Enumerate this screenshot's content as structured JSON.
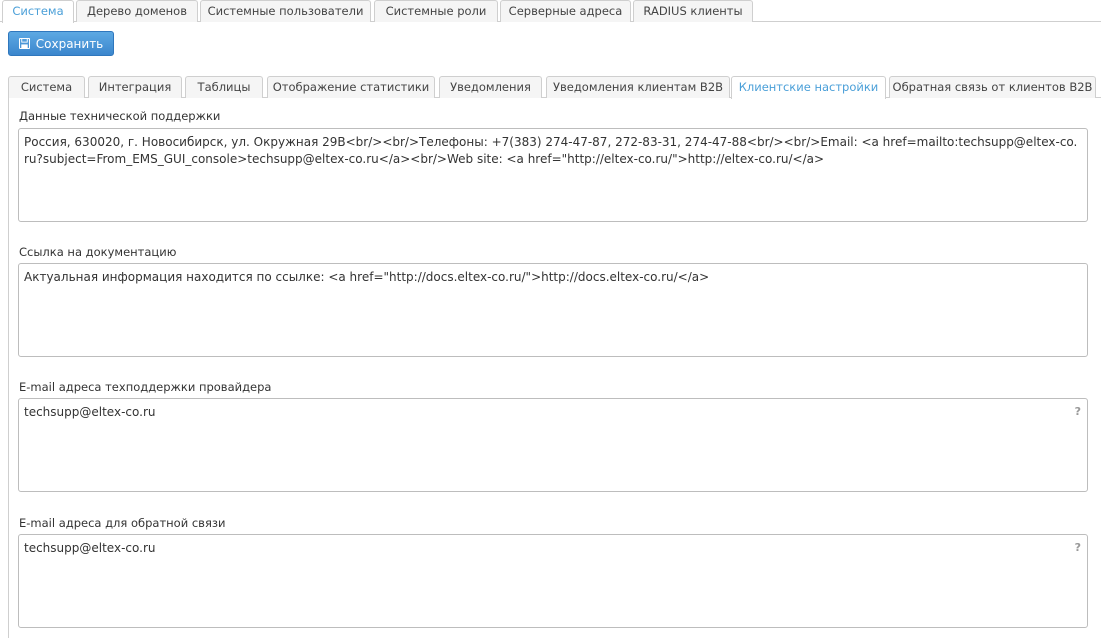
{
  "top_tabs": [
    {
      "label": "Система",
      "active": true
    },
    {
      "label": "Дерево доменов",
      "active": false
    },
    {
      "label": "Системные пользователи",
      "active": false
    },
    {
      "label": "Системные роли",
      "active": false
    },
    {
      "label": "Серверные адреса",
      "active": false
    },
    {
      "label": "RADIUS клиенты",
      "active": false
    }
  ],
  "toolbar": {
    "save_label": "Сохранить",
    "save_icon": "floppy-disk-icon"
  },
  "sub_tabs": [
    {
      "label": "Система",
      "active": false
    },
    {
      "label": "Интеграция",
      "active": false
    },
    {
      "label": "Таблицы",
      "active": false
    },
    {
      "label": "Отображение статистики",
      "active": false
    },
    {
      "label": "Уведомления",
      "active": false
    },
    {
      "label": "Уведомления клиентам B2B",
      "active": false
    },
    {
      "label": "Клиентские настройки",
      "active": true
    },
    {
      "label": "Обратная связь от клиентов B2B",
      "active": false
    }
  ],
  "fields": {
    "support_data": {
      "label": "Данные технической поддержки",
      "value": "Россия, 630020, г. Новосибирск, ул. Окружная 29В<br/><br/>Телефоны: +7(383) 274-47-87, 272-83-31, 274-47-88<br/><br/>Email:  <a href=mailto:techsupp@eltex-co.ru?subject=From_EMS_GUI_console>techsupp@eltex-co.ru</a><br/>Web site: <a href=\"http://eltex-co.ru/\">http://eltex-co.ru/</a>"
    },
    "docs_link": {
      "label": "Ссылка на документацию",
      "value": "Актуальная информация находится по ссылке: <a href=\"http://docs.eltex-co.ru/\">http://docs.eltex-co.ru/</a>"
    },
    "provider_email": {
      "label": "E-mail адреса техподдержки провайдера",
      "value": "techsupp@eltex-co.ru",
      "help": "?"
    },
    "feedback_email": {
      "label": "E-mail адреса для обратной связи",
      "value": "techsupp@eltex-co.ru",
      "help": "?"
    }
  },
  "colors": {
    "accent": "#4a9fd8",
    "button": "#3b86cd",
    "border": "#cfcfcf"
  }
}
